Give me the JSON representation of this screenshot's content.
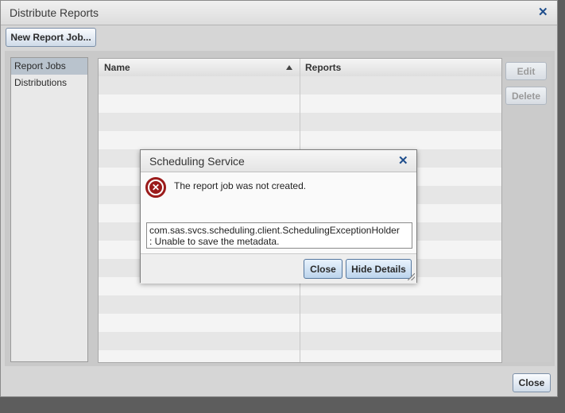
{
  "window": {
    "title": "Distribute Reports",
    "new_report_job_label": "New Report Job...",
    "close_label": "Close"
  },
  "sidebar": {
    "items": [
      {
        "label": "Report Jobs",
        "selected": true
      },
      {
        "label": "Distributions",
        "selected": false
      }
    ]
  },
  "grid": {
    "columns": [
      "Name",
      "Reports"
    ],
    "sort": "Name ascending",
    "rows": []
  },
  "actions": {
    "edit_label": "Edit",
    "delete_label": "Delete"
  },
  "dialog": {
    "title": "Scheduling Service",
    "message": "The report job was not created.",
    "details_line1": "com.sas.svcs.scheduling.client.SchedulingExceptionHolder",
    "details_line2": ": Unable to save the metadata.",
    "close_label": "Close",
    "hide_details_label": "Hide Details",
    "icon": "error-icon"
  },
  "colors": {
    "error": "#9b1b1b",
    "accent": "#1f4e8c"
  }
}
